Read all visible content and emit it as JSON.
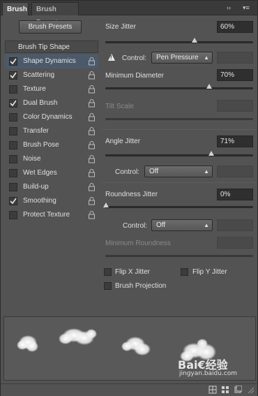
{
  "tabs": {
    "active": "Brush",
    "inactive": "Brush Presets"
  },
  "tab_icons": {
    "collapse": "››",
    "menu": "▾≡"
  },
  "brush_presets_button": "Brush Presets",
  "brush_tip_shape": "Brush Tip Shape",
  "list_items": [
    {
      "label": "Shape Dynamics",
      "checked": true,
      "selected": true
    },
    {
      "label": "Scattering",
      "checked": true,
      "selected": false
    },
    {
      "label": "Texture",
      "checked": false,
      "selected": false
    },
    {
      "label": "Dual Brush",
      "checked": true,
      "selected": false
    },
    {
      "label": "Color Dynamics",
      "checked": false,
      "selected": false
    },
    {
      "label": "Transfer",
      "checked": false,
      "selected": false
    },
    {
      "label": "Brush Pose",
      "checked": false,
      "selected": false
    },
    {
      "label": "Noise",
      "checked": false,
      "selected": false
    },
    {
      "label": "Wet Edges",
      "checked": false,
      "selected": false
    },
    {
      "label": "Build-up",
      "checked": false,
      "selected": false
    },
    {
      "label": "Smoothing",
      "checked": true,
      "selected": false
    },
    {
      "label": "Protect Texture",
      "checked": false,
      "selected": false
    }
  ],
  "size_jitter": {
    "label": "Size Jitter",
    "value": "60%",
    "level": 0.6
  },
  "size_control": {
    "label": "Control:",
    "value": "Pen Pressure"
  },
  "minimum_diameter": {
    "label": "Minimum Diameter",
    "value": "70%",
    "level": 0.7
  },
  "tilt_scale": {
    "label": "Tilt Scale"
  },
  "angle_jitter": {
    "label": "Angle Jitter",
    "value": "71%",
    "level": 0.71
  },
  "angle_control": {
    "label": "Control:",
    "value": "Off"
  },
  "roundness_jitter": {
    "label": "Roundness Jitter",
    "value": "0%",
    "level": 0.0
  },
  "roundness_control": {
    "label": "Control:",
    "value": "Off"
  },
  "minimum_roundness": {
    "label": "Minimum Roundness"
  },
  "flip_x": {
    "label": "Flip X Jitter",
    "checked": false
  },
  "flip_y": {
    "label": "Flip Y Jitter",
    "checked": false
  },
  "brush_projection": {
    "label": "Brush Projection",
    "checked": false
  },
  "watermark": {
    "brand": "Bai€经验",
    "url": "jingyan.baidu.com"
  },
  "colors": {
    "panel": "#535353",
    "selected_row": "#4b5a6b",
    "field": "#2f2f2f"
  }
}
